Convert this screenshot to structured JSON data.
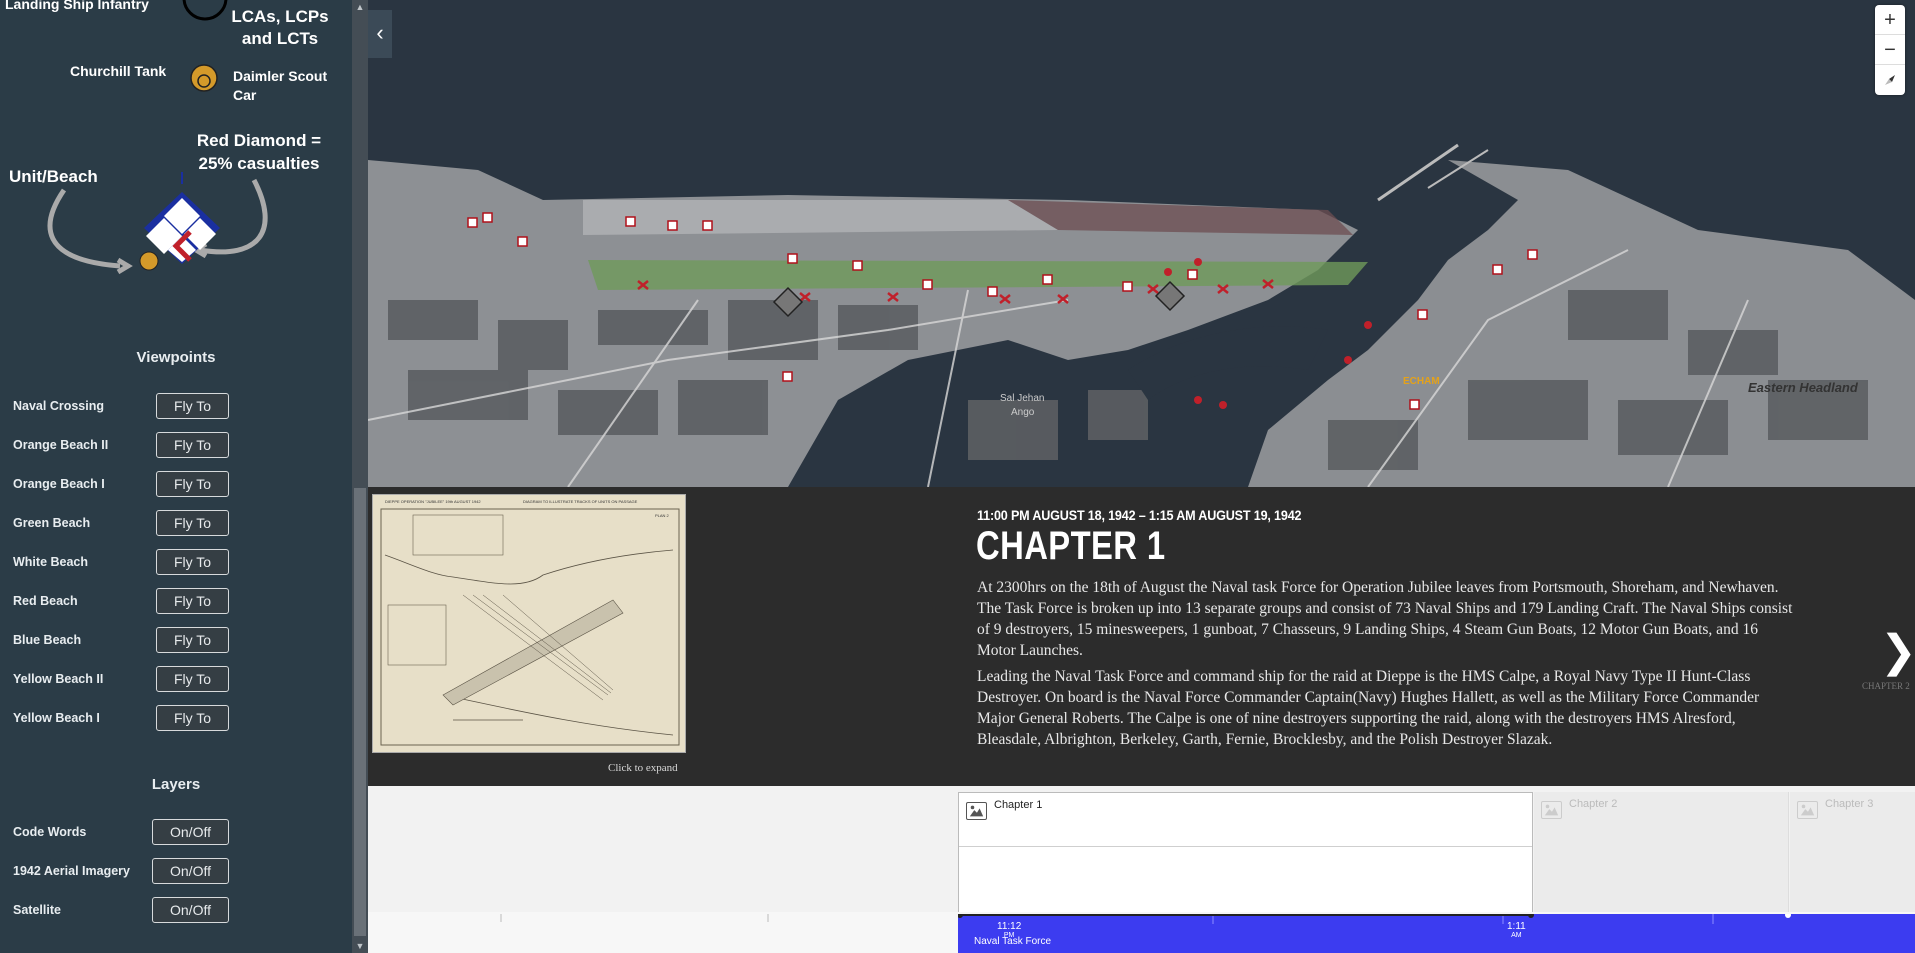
{
  "sidebar": {
    "legend": {
      "landing_ship": "Landing Ship Infantry",
      "lcas": "LCAs, LCPs and LCTs",
      "churchill": "Churchill Tank",
      "daimler": "Daimler Scout Car",
      "unit_beach": "Unit/Beach",
      "red_diamond": "Red Diamond = 25% casualties"
    },
    "viewpoints_title": "Viewpoints",
    "viewpoints": [
      {
        "label": "Naval Crossing",
        "button": "Fly To"
      },
      {
        "label": "Orange Beach II",
        "button": "Fly To"
      },
      {
        "label": "Orange Beach I",
        "button": "Fly To"
      },
      {
        "label": "Green Beach",
        "button": "Fly To"
      },
      {
        "label": "White Beach",
        "button": "Fly To"
      },
      {
        "label": "Red Beach",
        "button": "Fly To"
      },
      {
        "label": "Blue Beach",
        "button": "Fly To"
      },
      {
        "label": "Yellow Beach II",
        "button": "Fly To"
      },
      {
        "label": "Yellow Beach I",
        "button": "Fly To"
      }
    ],
    "layers_title": "Layers",
    "layers": [
      {
        "label": "Code Words",
        "button": "On/Off"
      },
      {
        "label": "1942 Aerial Imagery",
        "button": "On/Off"
      },
      {
        "label": "Satellite",
        "button": "On/Off"
      }
    ]
  },
  "map": {
    "labels": {
      "eastern_headland": "Eastern Headland",
      "echam": "ECHAM",
      "saint_jehan": "Sal Jehan",
      "ango": "Ango"
    },
    "zoom_in": "+",
    "zoom_out": "−",
    "collapse_icon": "chevron-left-icon"
  },
  "story": {
    "date": "11:00 PM AUGUST 18, 1942 – 1:15 AM AUGUST 19, 1942",
    "title": "CHAPTER 1",
    "para1": "At 2300hrs on the 18th of August the Naval task Force for Operation Jubilee leaves from Portsmouth, Shoreham, and Newhaven. The Task Force is broken up into 13 separate groups and consist of 73 Naval Ships and 179 Landing Craft. The Naval Ships consist of 9 destroyers, 15 minesweepers, 1 gunboat, 7 Chasseurs, 9 Landing Ships, 4 Steam Gun Boats, 12 Motor Gun Boats, and 16 Motor Launches.",
    "para2": "Leading the Naval Task Force and command ship for the raid at Dieppe is the HMS Calpe, a Royal Navy Type II Hunt-Class Destroyer. On board is the Naval Force Commander Captain(Navy) Hughes Hallett, as well as the Military Force Commander Major General Roberts. The Calpe is one of nine destroyers supporting the raid, along with the destroyers HMS Alresford, Bleasdale, Albrighton, Berkeley, Garth, Fernie, Brocklesby, and the Polish Destroyer Slazak.",
    "expand": "Click to expand",
    "next_label": "CHAPTER 2",
    "image": {
      "title": "DIEPPE OPERATION \"JUBILEE\" 19th AUGUST 1942",
      "subtitle": "DIAGRAM TO ILLUSTRATE TRACKS OF UNITS ON PASSAGE",
      "plan": "PLAN 2"
    }
  },
  "timeline": {
    "chapters": [
      "Chapter 1",
      "Chapter 2",
      "Chapter 3"
    ],
    "tick1": "11:12",
    "tick1_sub": "PM",
    "tick2": "1:11",
    "tick2_sub": "AM",
    "group": "Naval Task Force"
  },
  "colors": {
    "sidebar_bg": "#2b3c47",
    "story_bg": "#2c2c2c",
    "timeline_blue": "#3c3cf0",
    "diamond_blue": "#1a2fa0",
    "casualty_red": "#c0202a",
    "tank_orange": "#d49a2a"
  }
}
